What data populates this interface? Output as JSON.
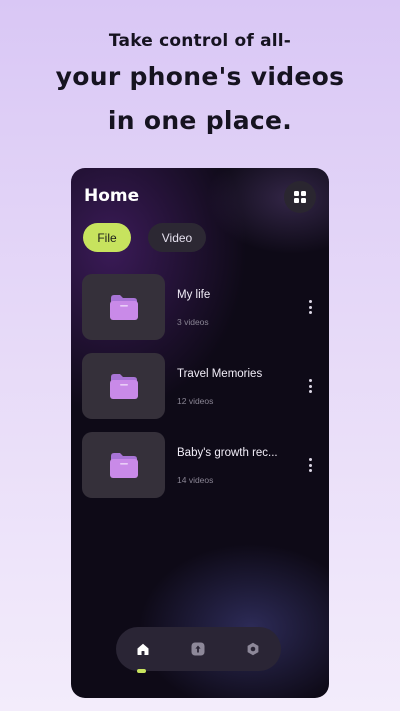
{
  "headline": {
    "line1": "Take control of all-",
    "line2": "your phone's videos",
    "line3": "in one place."
  },
  "app": {
    "title": "Home",
    "tabs": [
      {
        "label": "File",
        "active": true
      },
      {
        "label": "Video",
        "active": false
      }
    ],
    "folders": [
      {
        "name": "My life",
        "count": "3 videos"
      },
      {
        "name": "Travel Memories",
        "count": "12 videos"
      },
      {
        "name": "Baby's growth rec...",
        "count": "14 videos"
      }
    ],
    "bottom_nav": [
      {
        "icon": "home-icon",
        "active": true
      },
      {
        "icon": "upload-icon",
        "active": false
      },
      {
        "icon": "settings-icon",
        "active": false
      }
    ]
  },
  "colors": {
    "accent": "#c7e35e",
    "folder": "#c98ae8",
    "background_top": "#d9c7f5"
  }
}
